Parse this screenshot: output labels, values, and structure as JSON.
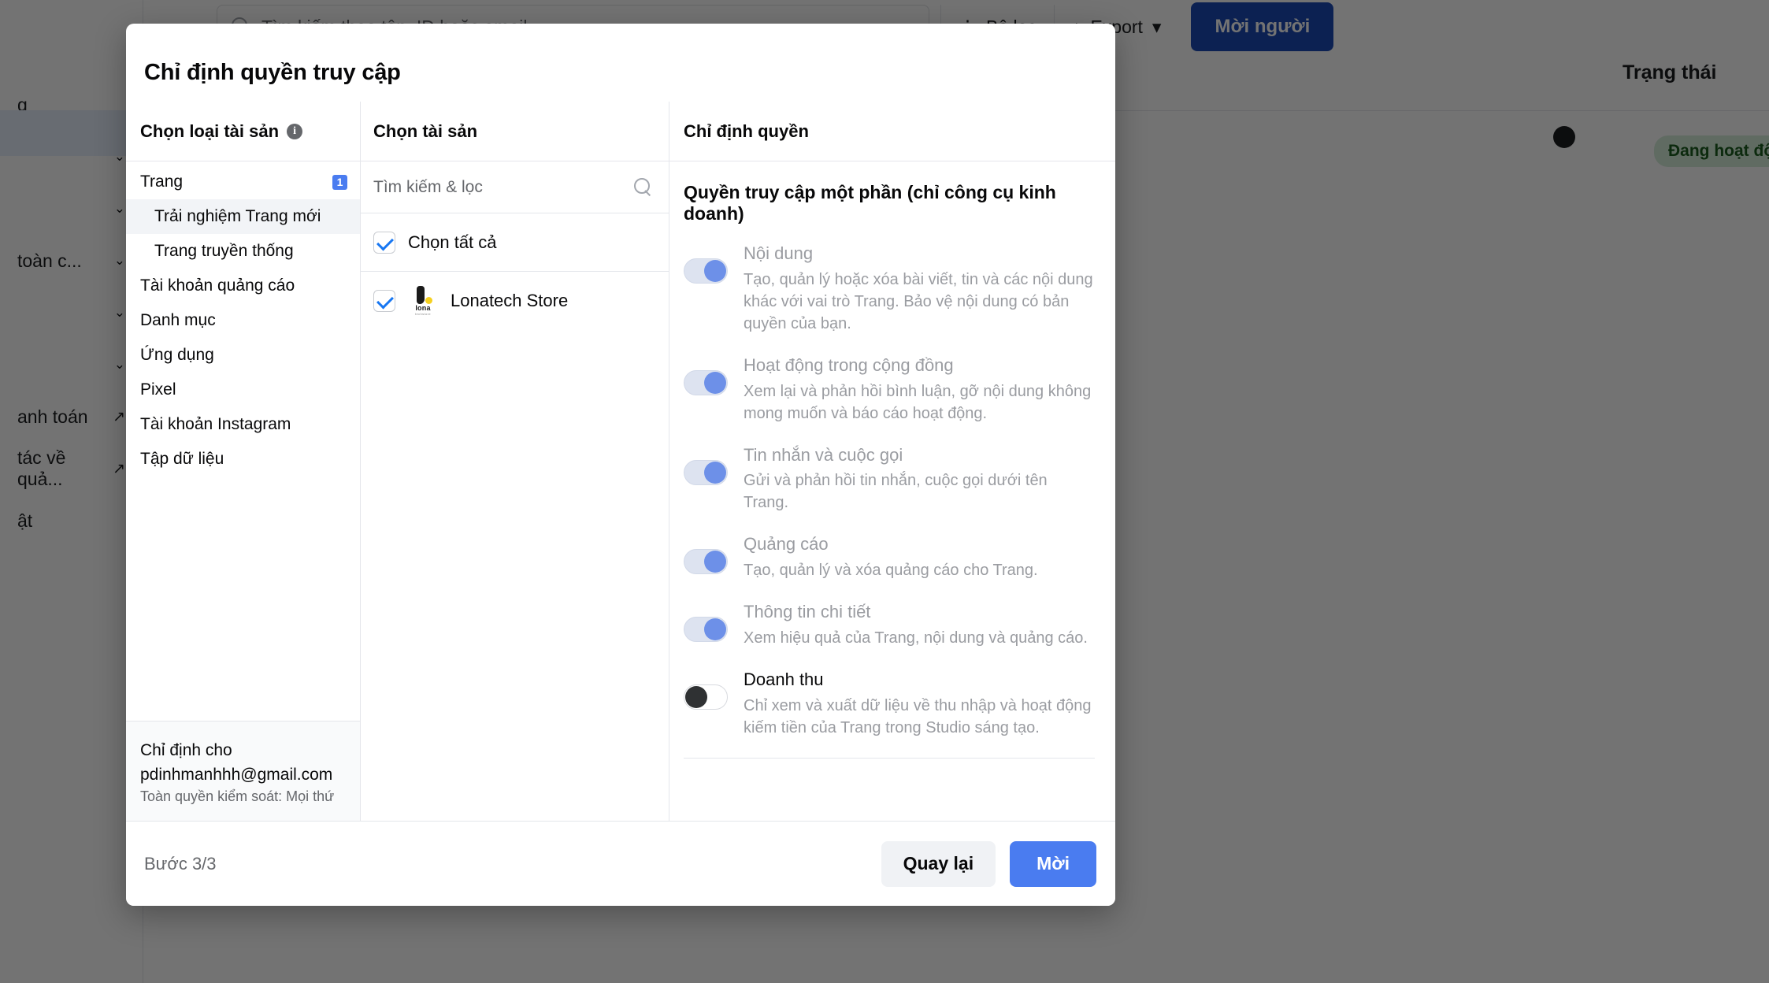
{
  "background": {
    "search_placeholder": "Tìm kiếm theo tên, ID hoặc email",
    "filter_label": "Bộ lọc",
    "export_label": "Export",
    "invite_label": "Mời người",
    "status_column": "Trạng thái",
    "status_badge": "Đang hoạt độ",
    "sidebar_items": [
      {
        "label": "g",
        "chevron": ""
      },
      {
        "label": "",
        "chevron": "⌄"
      },
      {
        "label": "",
        "chevron": "⌄"
      },
      {
        "label": "toàn c...",
        "chevron": "⌄"
      },
      {
        "label": "",
        "chevron": "⌄"
      },
      {
        "label": "",
        "chevron": "⌄"
      },
      {
        "label": "anh toán",
        "chevron": ""
      },
      {
        "label": "tác về quả...",
        "chevron": ""
      },
      {
        "label": "ật",
        "chevron": ""
      }
    ],
    "icons": {
      "search": "search-icon",
      "filter": "filter-icon",
      "export": "download-icon",
      "caret": "caret-down-icon",
      "external": "external-link-icon"
    }
  },
  "modal": {
    "title": "Chỉ định quyền truy cập",
    "columns": {
      "asset_type": {
        "heading": "Chọn loại tài sản",
        "info_icon": "info-icon",
        "items": [
          {
            "label": "Trang",
            "badge": "1",
            "sub": false,
            "active": false
          },
          {
            "label": "Trải nghiệm Trang mới",
            "badge": "",
            "sub": true,
            "active": true
          },
          {
            "label": "Trang truyền thống",
            "badge": "",
            "sub": true,
            "active": false
          },
          {
            "label": "Tài khoản quảng cáo",
            "badge": "",
            "sub": false,
            "active": false
          },
          {
            "label": "Danh mục",
            "badge": "",
            "sub": false,
            "active": false
          },
          {
            "label": "Ứng dụng",
            "badge": "",
            "sub": false,
            "active": false
          },
          {
            "label": "Pixel",
            "badge": "",
            "sub": false,
            "active": false
          },
          {
            "label": "Tài khoản Instagram",
            "badge": "",
            "sub": false,
            "active": false
          },
          {
            "label": "Tập dữ liệu",
            "badge": "",
            "sub": false,
            "active": false
          }
        ],
        "assign_to_label": "Chỉ định cho",
        "assign_to_email": "pdinhmanhhh@gmail.com",
        "assign_to_access": "Toàn quyền kiểm soát: Mọi thứ"
      },
      "assets": {
        "heading": "Chọn tài sản",
        "search_placeholder": "Tìm kiếm & lọc",
        "search_icon": "search-icon",
        "select_all_label": "Chọn tất cả",
        "select_all_checked": true,
        "rows": [
          {
            "name": "Lonatech Store",
            "checked": true,
            "logo_word": "lona",
            "logo_sub": "techstore"
          }
        ]
      },
      "permissions": {
        "heading": "Chỉ định quyền",
        "group_title": "Quyền truy cập một phần (chỉ công cụ kinh doanh)",
        "items": [
          {
            "label": "Nội dung",
            "description": "Tạo, quản lý hoặc xóa bài viết, tin và các nội dung khác với vai trò Trang. Bảo vệ nội dung có bản quyền của bạn.",
            "state": "on",
            "disabled": true
          },
          {
            "label": "Hoạt động trong cộng đồng",
            "description": "Xem lại và phản hồi bình luận, gỡ nội dung không mong muốn và báo cáo hoạt động.",
            "state": "on",
            "disabled": true
          },
          {
            "label": "Tin nhắn và cuộc gọi",
            "description": "Gửi và phản hồi tin nhắn, cuộc gọi dưới tên Trang.",
            "state": "on",
            "disabled": true
          },
          {
            "label": "Quảng cáo",
            "description": "Tạo, quản lý và xóa quảng cáo cho Trang.",
            "state": "on",
            "disabled": true
          },
          {
            "label": "Thông tin chi tiết",
            "description": "Xem hiệu quả của Trang, nội dung và quảng cáo.",
            "state": "on",
            "disabled": true
          },
          {
            "label": "Doanh thu",
            "description": "Chỉ xem và xuất dữ liệu về thu nhập và hoạt động kiếm tiền của Trang trong Studio sáng tạo.",
            "state": "off",
            "disabled": false
          }
        ]
      }
    },
    "footer": {
      "step": "Bước 3/3",
      "back_label": "Quay lại",
      "invite_label": "Mời"
    }
  },
  "colors": {
    "primary": "#4a7cf0",
    "badge_blue": "#4a7cf0",
    "toggle_on_thumb": "#6d90e8",
    "toggle_on_track": "#dde3f0",
    "toggle_off_thumb": "#2f3133",
    "check_blue": "#1877f2",
    "text_primary": "#080809",
    "text_muted": "#65676b",
    "text_disabled": "#9a9ca1"
  }
}
